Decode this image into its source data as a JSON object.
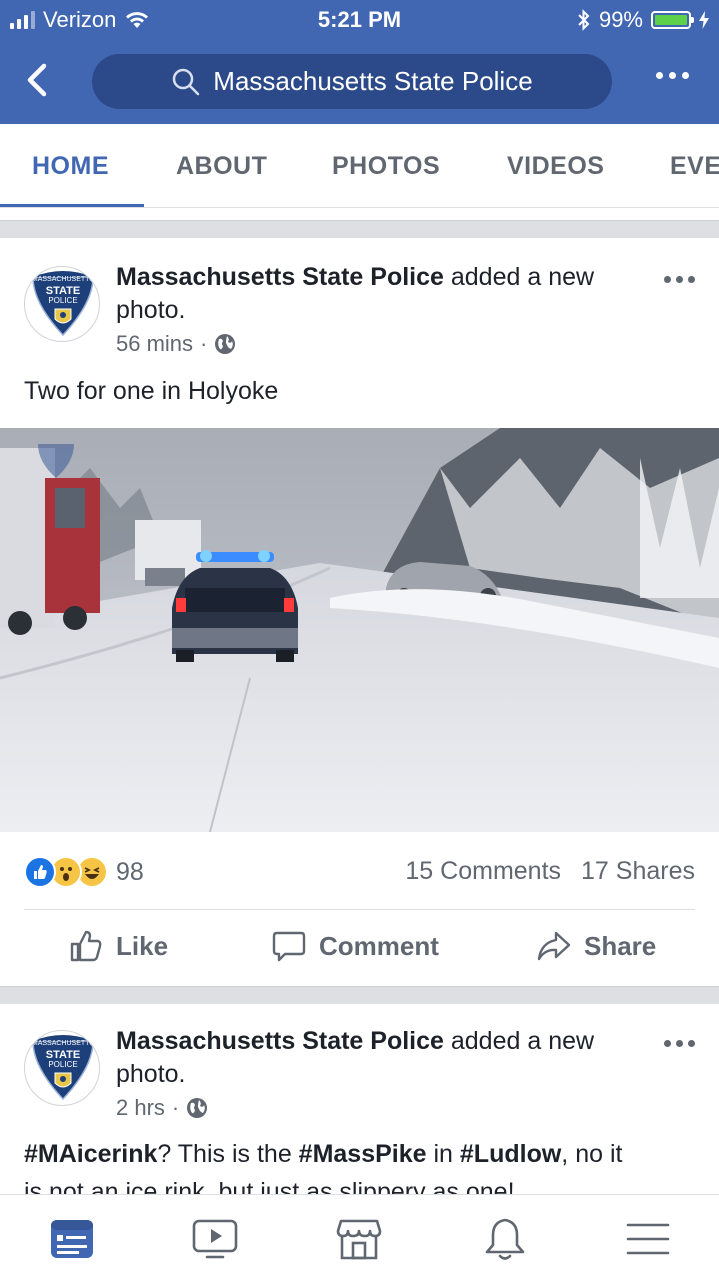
{
  "status": {
    "carrier": "Verizon",
    "time": "5:21 PM",
    "battery": "99%",
    "battery_level": 0.99
  },
  "nav": {
    "search_text": "Massachusetts State Police"
  },
  "tabs": [
    "HOME",
    "ABOUT",
    "PHOTOS",
    "VIDEOS",
    "EVE"
  ],
  "posts": [
    {
      "author": "Massachusetts State Police",
      "action": "added a new photo.",
      "time": "56 mins",
      "text": "Two for one in Holyoke",
      "reaction_count": "98",
      "comments": "15 Comments",
      "shares": "17 Shares"
    },
    {
      "author": "Massachusetts State Police",
      "action": "added a new photo.",
      "time": "2 hrs",
      "text_parts": [
        "#MAicerink",
        "? This is the ",
        "#MassPike",
        " in ",
        "#Ludlow",
        ", no it"
      ],
      "text_cut": "is not an ice rink, but just as slippery as one!"
    }
  ],
  "actions": {
    "like": "Like",
    "comment": "Comment",
    "share": "Share"
  },
  "logo": {
    "line1": "MASSACHUSETTS",
    "line2": "STATE",
    "line3": "POLICE"
  },
  "colors": {
    "brand": "#4267b2",
    "search_bg": "#2c4a8a",
    "muted": "#606770"
  }
}
